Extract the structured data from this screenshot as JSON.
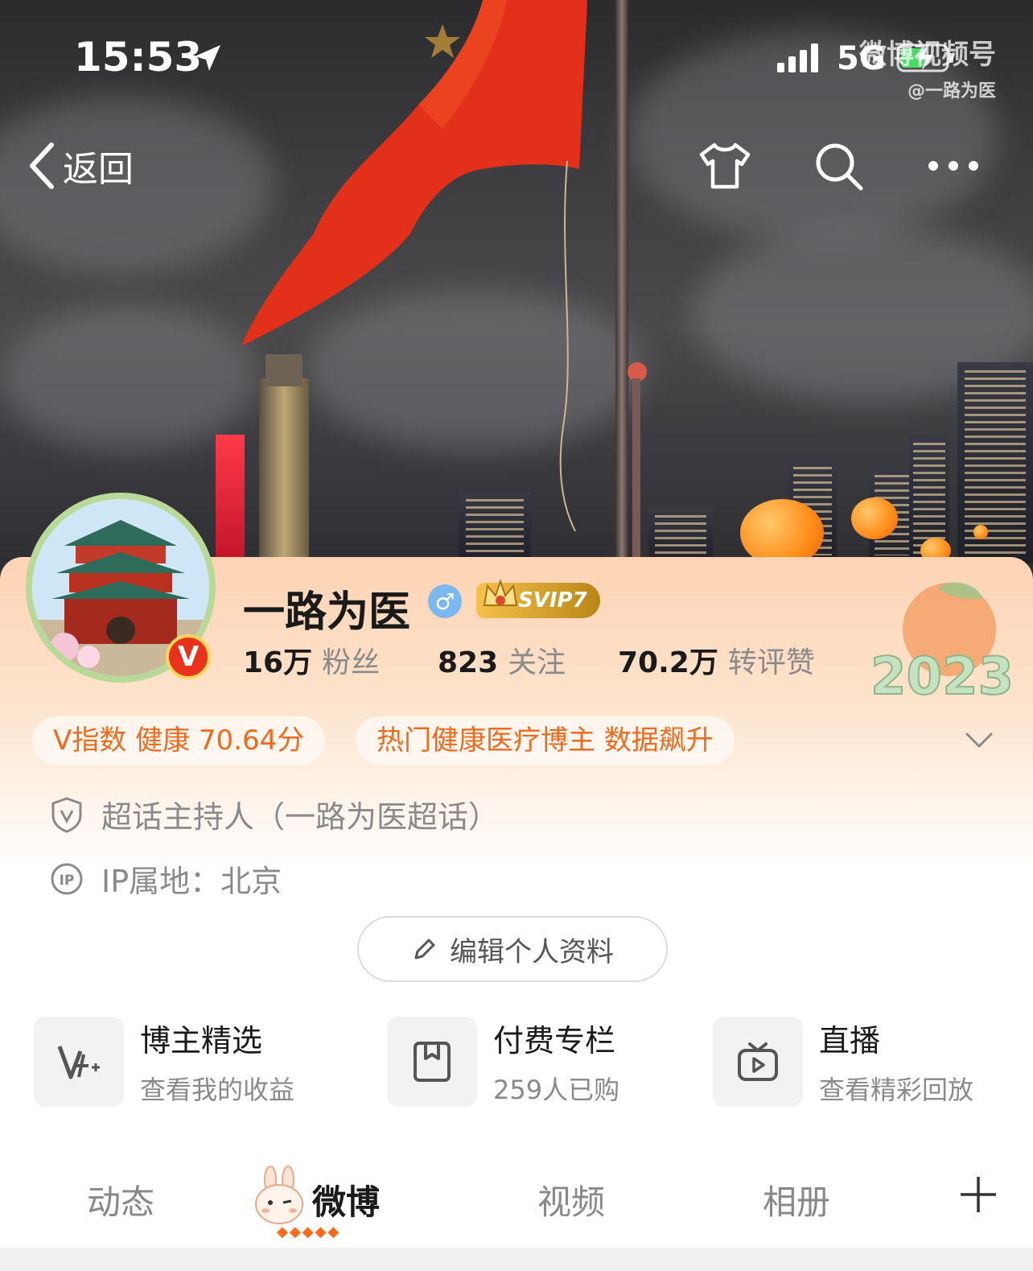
{
  "status_bar": {
    "time": "15:53",
    "network": "5G"
  },
  "watermark": {
    "line1": "微博视频号",
    "line2": "@一路为医"
  },
  "nav": {
    "back_label": "返回"
  },
  "profile": {
    "name": "一路为医",
    "gender_symbol": "♂",
    "vip_label": "SVIP7",
    "verified_badge": "V",
    "stats": [
      {
        "value": "16万",
        "label": "粉丝"
      },
      {
        "value": "823",
        "label": "关注"
      },
      {
        "value": "70.2万",
        "label": "转评赞"
      }
    ],
    "decoration_year": "2023"
  },
  "tags": [
    "V指数 健康 70.64分",
    "热门健康医疗博主 数据飙升"
  ],
  "info": {
    "super_topic": "超话主持人（一路为医超话）",
    "ip_location": "IP属地：北京"
  },
  "edit_button_label": "编辑个人资料",
  "features": [
    {
      "title": "博主精选",
      "subtitle": "查看我的收益",
      "icon": "v-plus-icon"
    },
    {
      "title": "付费专栏",
      "subtitle": "259人已购",
      "icon": "bookmark-icon"
    },
    {
      "title": "直播",
      "subtitle": "查看精彩回放",
      "icon": "tv-play-icon"
    }
  ],
  "tabs": [
    {
      "label": "动态",
      "active": false
    },
    {
      "label": "微博",
      "active": true
    },
    {
      "label": "视频",
      "active": false
    },
    {
      "label": "相册",
      "active": false
    }
  ],
  "colors": {
    "accent": "#f06a1e",
    "card_top": "#fdd3b4",
    "svip_gold": "#f6c24b",
    "verify_red": "#e8321c"
  }
}
